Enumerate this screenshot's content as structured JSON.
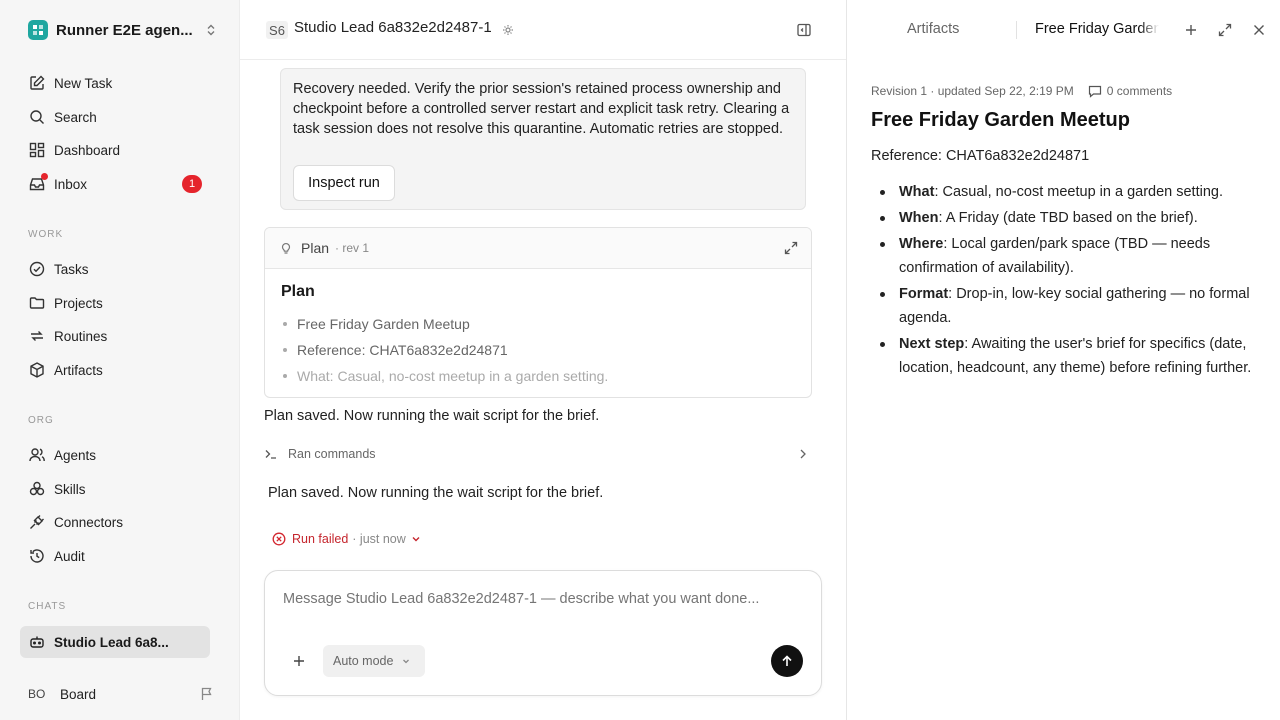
{
  "sidebar": {
    "workspace_name": "Runner E2E agen...",
    "nav_main": [
      {
        "label": "New Task",
        "icon": "edit-icon"
      },
      {
        "label": "Search",
        "icon": "search-icon"
      },
      {
        "label": "Dashboard",
        "icon": "dashboard-icon"
      },
      {
        "label": "Inbox",
        "icon": "inbox-icon",
        "badge": "1"
      }
    ],
    "section_work": "WORK",
    "nav_work": [
      {
        "label": "Tasks",
        "icon": "check-circle-icon"
      },
      {
        "label": "Projects",
        "icon": "folder-icon"
      },
      {
        "label": "Routines",
        "icon": "repeat-icon"
      },
      {
        "label": "Artifacts",
        "icon": "cube-icon"
      }
    ],
    "section_org": "ORG",
    "nav_org": [
      {
        "label": "Agents",
        "icon": "users-icon"
      },
      {
        "label": "Skills",
        "icon": "skills-icon"
      },
      {
        "label": "Connectors",
        "icon": "plug-icon"
      },
      {
        "label": "Audit",
        "icon": "history-icon"
      }
    ],
    "section_chats": "CHATS",
    "chat_item": "Studio Lead 6a8...",
    "user_initials": "BO",
    "user_name": "Board"
  },
  "main": {
    "agent_badge": "S6",
    "agent_title": "Studio Lead 6a832e2d2487-1",
    "recovery_text": "Recovery needed. Verify the prior session's retained process ownership and checkpoint before a controlled server restart and explicit task retry. Clearing a task session does not resolve this quarantine. Automatic retries are stopped.",
    "inspect_button": "Inspect run",
    "plan_label": "Plan",
    "plan_rev": "· rev 1",
    "plan_heading": "Plan",
    "plan_items": [
      "Free Friday Garden Meetup",
      "Reference: CHAT6a832e2d24871",
      "What: Casual, no-cost meetup in a garden setting."
    ],
    "message_1": "Plan saved. Now running the wait script for the brief.",
    "ran_commands": "Ran commands",
    "message_2": "Plan saved. Now running the wait script for the brief.",
    "run_status": "Run failed",
    "run_time": "· just now",
    "composer_placeholder": "Message Studio Lead 6a832e2d2487-1 — describe what you want done...",
    "mode_label": "Auto mode"
  },
  "right_panel": {
    "tab_artifacts": "Artifacts",
    "tab_active": "Free Friday Garden Meetup",
    "meta_revision": "Revision 1 · updated Sep 22, 2:19 PM",
    "meta_comments": "0 comments",
    "doc_title": "Free Friday Garden Meetup",
    "doc_reference": "Reference: CHAT6a832e2d24871",
    "doc_items": [
      {
        "label": "What",
        "text": ": Casual, no-cost meetup in a garden setting."
      },
      {
        "label": "When",
        "text": ": A Friday (date TBD based on the brief)."
      },
      {
        "label": "Where",
        "text": ": Local garden/park space (TBD — needs confirmation of availability)."
      },
      {
        "label": "Format",
        "text": ": Drop-in, low-key social gathering — no formal agenda."
      },
      {
        "label": "Next step",
        "text": ": Awaiting the user's brief for specifics (date, location, headcount, any theme) before refining further."
      }
    ]
  },
  "colors": {
    "accent_red": "#e5242c",
    "workspace_logo": "#1fa7a0"
  }
}
